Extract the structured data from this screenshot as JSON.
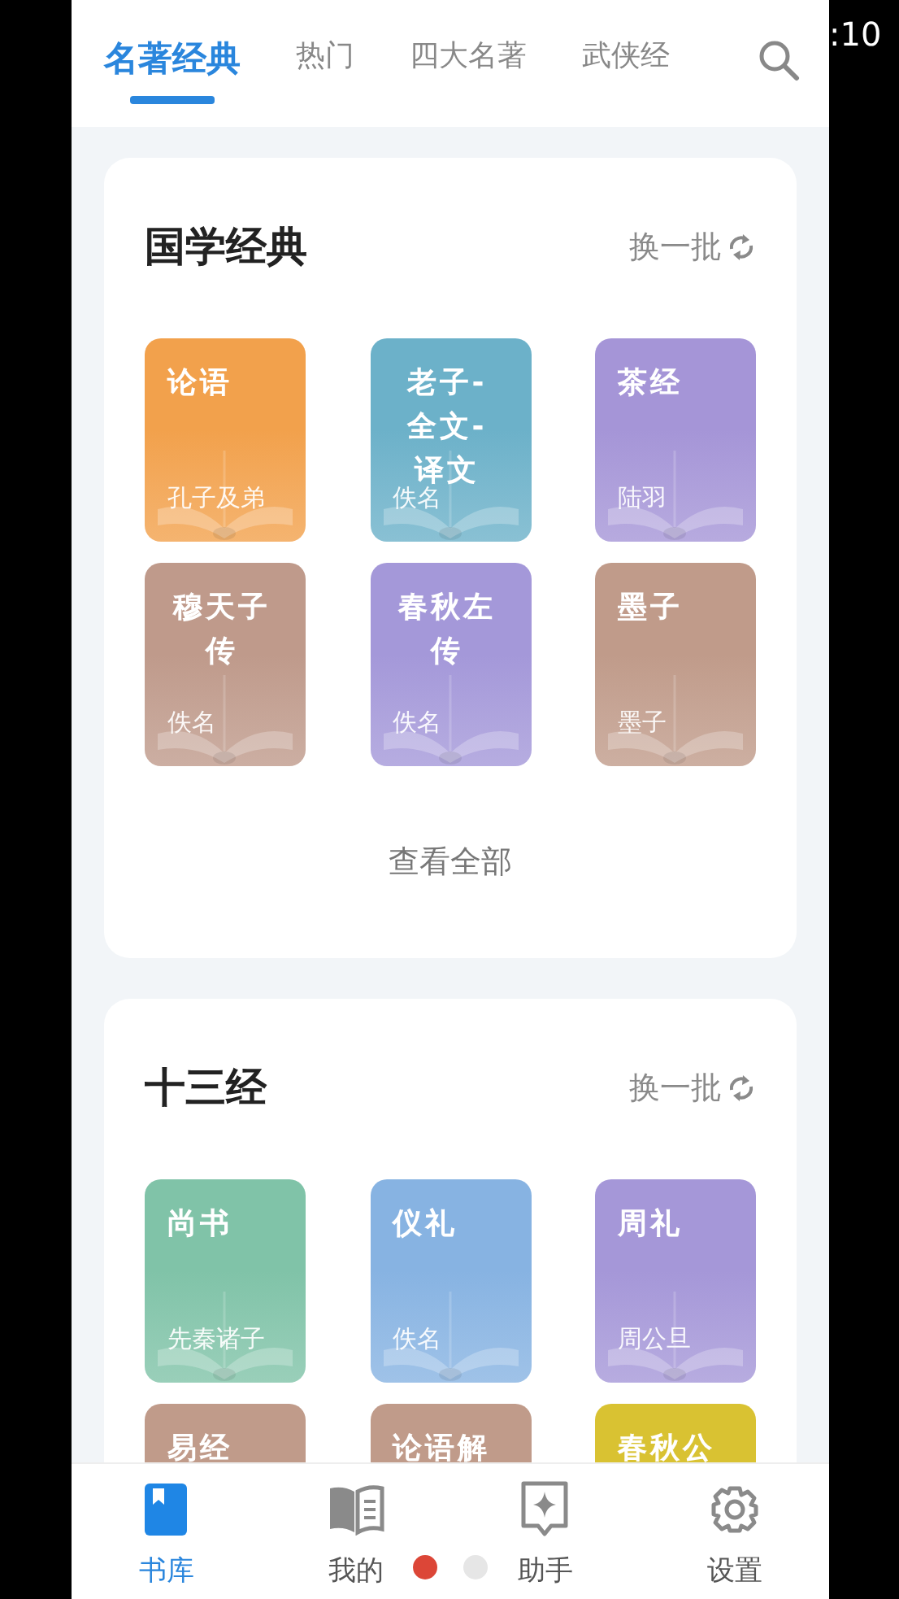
{
  "status_bar": {
    "time": ":10"
  },
  "tabs": [
    {
      "label": "名著经典",
      "selected": true
    },
    {
      "label": "热门",
      "selected": false
    },
    {
      "label": "四大名著",
      "selected": false
    },
    {
      "label": "武侠经",
      "selected": false
    }
  ],
  "sections": [
    {
      "title": "国学经典",
      "refresh_label": "换一批",
      "view_all": "查看全部",
      "books": [
        {
          "title": "论语",
          "author": "孔子及弟",
          "color": "#f2a14c"
        },
        {
          "title": "老子-全文-译文",
          "author": "佚名",
          "color": "#6cb1c9"
        },
        {
          "title": "茶经",
          "author": "陆羽",
          "color": "#a595d7"
        },
        {
          "title": "穆天子传",
          "author": "佚名",
          "color": "#bf9a8b"
        },
        {
          "title": "春秋左传",
          "author": "佚名",
          "color": "#a498d9"
        },
        {
          "title": "墨子",
          "author": "墨子",
          "color": "#c09b8a"
        }
      ]
    },
    {
      "title": "十三经",
      "refresh_label": "换一批",
      "books": [
        {
          "title": "尚书",
          "author": "先秦诸子",
          "color": "#80c3a8"
        },
        {
          "title": "仪礼",
          "author": "佚名",
          "color": "#87b3e2"
        },
        {
          "title": "周礼",
          "author": "周公旦",
          "color": "#a597d8"
        },
        {
          "title": "易经",
          "color": "#c09b8a"
        },
        {
          "title": "论语解",
          "color": "#c09b8a"
        },
        {
          "title": "春秋公",
          "color": "#d9c232"
        }
      ]
    }
  ],
  "bottom_nav": [
    {
      "label": "书库",
      "selected": true
    },
    {
      "label": "我的",
      "selected": false
    },
    {
      "label": "助手",
      "selected": false
    },
    {
      "label": "设置",
      "selected": false
    }
  ],
  "page_dots": [
    {
      "selected": true
    },
    {
      "selected": false
    }
  ]
}
